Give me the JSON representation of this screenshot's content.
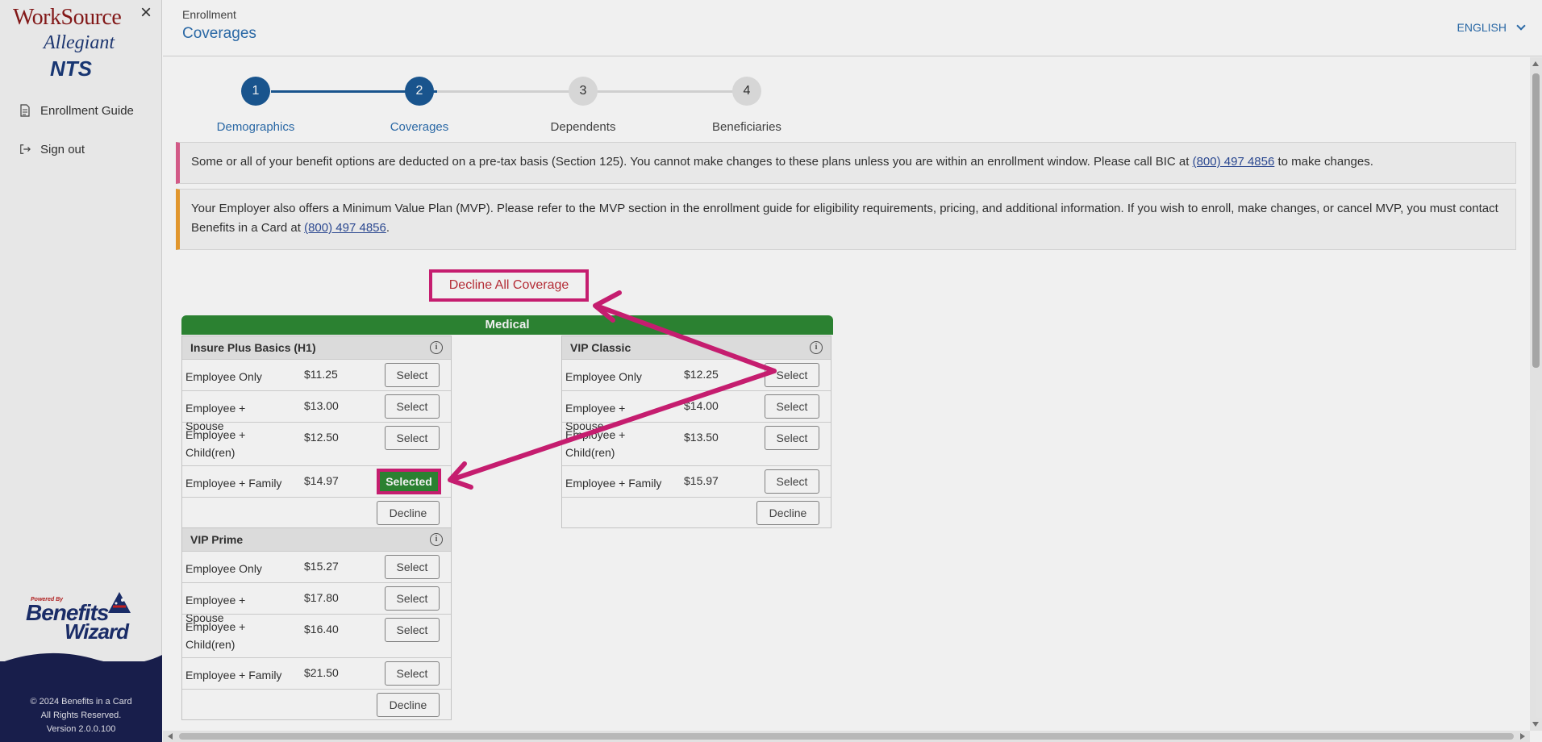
{
  "sidebar": {
    "logo_worksource": "WorkSource",
    "logo_allegiant": "Allegiant",
    "logo_nts": "NTS",
    "nav": [
      {
        "label": "Enrollment Guide",
        "icon": "document-icon"
      },
      {
        "label": "Sign out",
        "icon": "sign-out-icon"
      }
    ],
    "bw_powered": "Powered By",
    "bw_benefits": "Benefits",
    "bw_wizard": "Wizard",
    "footer": {
      "copyright": "© 2024 Benefits in a Card",
      "rights": "All Rights Reserved.",
      "version": "Version 2.0.0.100"
    }
  },
  "header": {
    "breadcrumb": "Enrollment",
    "title": "Coverages",
    "language": "ENGLISH"
  },
  "stepper": {
    "steps": [
      {
        "num": "1",
        "label": "Demographics",
        "state": "done"
      },
      {
        "num": "2",
        "label": "Coverages",
        "state": "done"
      },
      {
        "num": "3",
        "label": "Dependents",
        "state": "todo"
      },
      {
        "num": "4",
        "label": "Beneficiaries",
        "state": "todo"
      }
    ]
  },
  "alerts": {
    "pretax_text": "Some or all of your benefit options are deducted on a pre-tax basis (Section 125). You cannot make changes to these plans unless you are within an enrollment window. Please call BIC at",
    "pretax_phone": "(800) 497 4856",
    "pretax_tail": "to make changes.",
    "mvp_text": "Your Employer also offers a Minimum Value Plan (MVP). Please refer to the MVP section in the enrollment guide for eligibility requirements, pricing, and additional information. If you wish to enroll, make changes, or cancel MVP, you must contact Benefits in a Card at",
    "mvp_phone": "(800) 497 4856",
    "mvp_tail": "."
  },
  "decline_all_label": "Decline All Coverage",
  "medical": {
    "section_label": "Medical",
    "select_label": "Select",
    "selected_label": "Selected",
    "decline_label": "Decline",
    "info_glyph": "i",
    "plans": {
      "insure_plus": {
        "name": "Insure Plus Basics (H1)",
        "tiers": [
          {
            "tier": "Employee Only",
            "price": "$11.25"
          },
          {
            "tier": "Employee + Spouse",
            "price": "$13.00"
          },
          {
            "tier": "Employee + Child(ren)",
            "price": "$12.50"
          },
          {
            "tier": "Employee + Family",
            "price": "$14.97"
          }
        ]
      },
      "vip_classic": {
        "name": "VIP Classic",
        "tiers": [
          {
            "tier": "Employee Only",
            "price": "$12.25"
          },
          {
            "tier": "Employee + Spouse",
            "price": "$14.00"
          },
          {
            "tier": "Employee + Child(ren)",
            "price": "$13.50"
          },
          {
            "tier": "Employee + Family",
            "price": "$15.97"
          }
        ]
      },
      "vip_prime": {
        "name": "VIP Prime",
        "tiers": [
          {
            "tier": "Employee Only",
            "price": "$15.27"
          },
          {
            "tier": "Employee + Spouse",
            "price": "$17.80"
          },
          {
            "tier": "Employee + Child(ren)",
            "price": "$16.40"
          },
          {
            "tier": "Employee + Family",
            "price": "$21.50"
          }
        ]
      }
    }
  },
  "colors": {
    "accent_blue": "#2d6fb0",
    "step_done": "#1b5a96",
    "medical_green": "#2e8a35",
    "highlight_magenta": "#d21f76",
    "decline_all_text": "#c0303a"
  }
}
